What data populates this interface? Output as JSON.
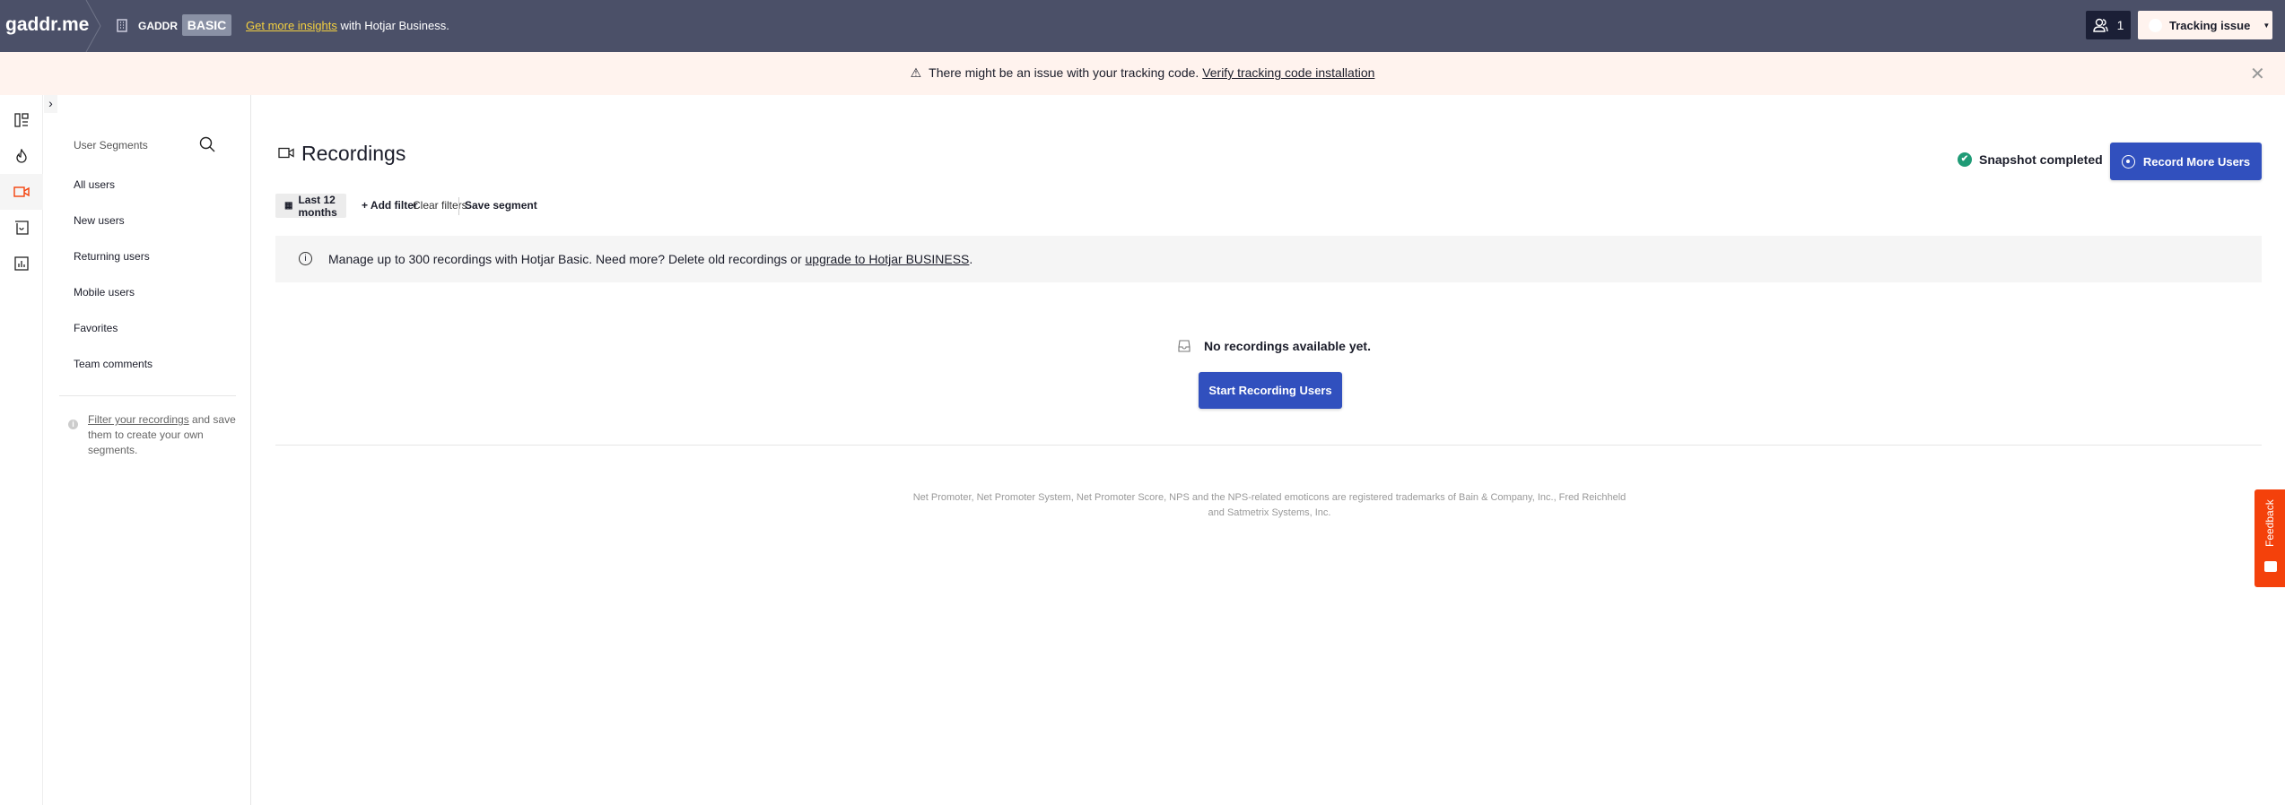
{
  "header": {
    "logo": "gaddr.me",
    "org": "GADDR",
    "plan": "BASIC",
    "promo_link": "Get more insights",
    "promo_rest": " with Hotjar Business.",
    "users_count": "1",
    "tracking_label": "Tracking issue"
  },
  "banner": {
    "text": "There might be an issue with your tracking code. ",
    "link": "Verify tracking code installation"
  },
  "nav": {
    "icons": [
      "dashboard-icon",
      "heatmaps-icon",
      "recordings-icon",
      "feedback-icon",
      "surveys-icon"
    ],
    "active": "recordings-icon",
    "accent": "#f4410b"
  },
  "segments": {
    "title": "User Segments",
    "items": [
      "All users",
      "New users",
      "Returning users",
      "Mobile users",
      "Favorites",
      "Team comments"
    ],
    "info_link": "Filter your recordings",
    "info_rest": " and save them to create your own segments."
  },
  "main": {
    "title": "Recordings",
    "snapshot": "Snapshot completed",
    "record_more": "Record More Users",
    "date_filter": "Last 12 months",
    "add_filter": "+ Add filter",
    "clear_filters": "Clear filters",
    "save_segment": "Save segment",
    "info": "Manage up to 300 recordings with Hotjar Basic. Need more? Delete old recordings or ",
    "info_link": "upgrade to Hotjar BUSINESS",
    "info_end": ".",
    "empty": "No recordings available yet.",
    "start_recording": "Start Recording Users",
    "footer": "Net Promoter, Net Promoter System, Net Promoter Score, NPS and the NPS-related emoticons are registered trademarks of Bain & Company, Inc., Fred Reichheld and Satmetrix Systems, Inc."
  },
  "feedback": "Feedback",
  "colors": {
    "header": "#4b5068",
    "primary": "#3150be",
    "success": "#1f9b76",
    "banner": "#fff3ee"
  }
}
